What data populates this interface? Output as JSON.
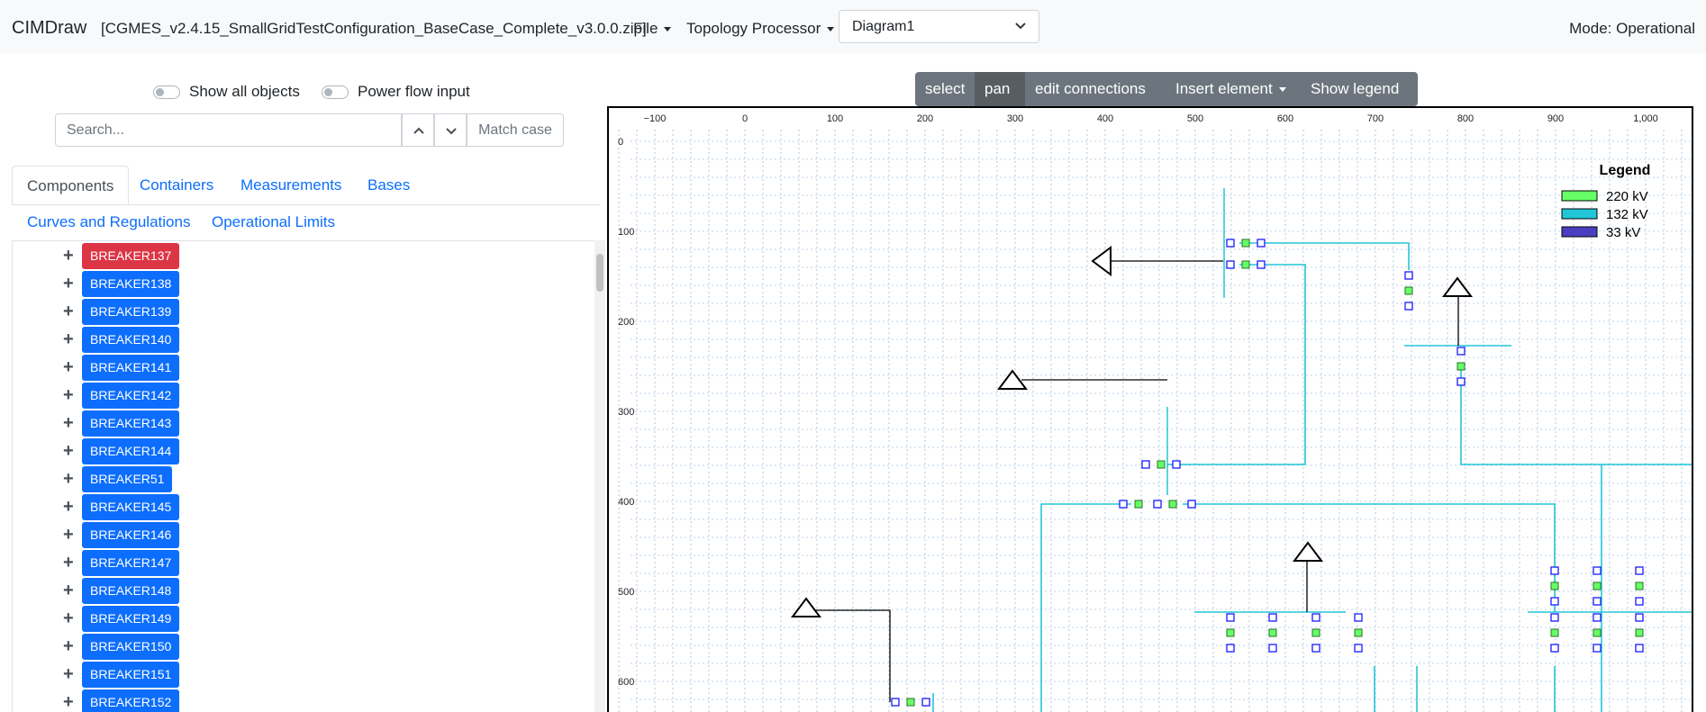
{
  "navbar": {
    "brand": "CIMDraw",
    "filename": "[CGMES_v2.4.15_SmallGridTestConfiguration_BaseCase_Complete_v3.0.0.zip]",
    "file_menu": "File",
    "topology_menu": "Topology Processor",
    "diagram_select": "Diagram1",
    "mode": "Mode: Operational"
  },
  "options": {
    "show_all_objects": "Show all objects",
    "power_flow_input": "Power flow input"
  },
  "search": {
    "placeholder": "Search...",
    "match_case": "Match case"
  },
  "tabs": {
    "components": "Components",
    "containers": "Containers",
    "measurements": "Measurements",
    "bases": "Bases",
    "curves": "Curves and Regulations",
    "limits": "Operational Limits"
  },
  "tree_items": [
    {
      "label": "BREAKER137",
      "color": "#dc3545"
    },
    {
      "label": "BREAKER138",
      "color": "#0d6efd"
    },
    {
      "label": "BREAKER139",
      "color": "#0d6efd"
    },
    {
      "label": "BREAKER140",
      "color": "#0d6efd"
    },
    {
      "label": "BREAKER141",
      "color": "#0d6efd"
    },
    {
      "label": "BREAKER142",
      "color": "#0d6efd"
    },
    {
      "label": "BREAKER143",
      "color": "#0d6efd"
    },
    {
      "label": "BREAKER144",
      "color": "#0d6efd"
    },
    {
      "label": "BREAKER51",
      "color": "#0d6efd"
    },
    {
      "label": "BREAKER145",
      "color": "#0d6efd"
    },
    {
      "label": "BREAKER146",
      "color": "#0d6efd"
    },
    {
      "label": "BREAKER147",
      "color": "#0d6efd"
    },
    {
      "label": "BREAKER148",
      "color": "#0d6efd"
    },
    {
      "label": "BREAKER149",
      "color": "#0d6efd"
    },
    {
      "label": "BREAKER150",
      "color": "#0d6efd"
    },
    {
      "label": "BREAKER151",
      "color": "#0d6efd"
    },
    {
      "label": "BREAKER152",
      "color": "#0d6efd"
    }
  ],
  "toolbar": {
    "select": "select",
    "pan": "pan",
    "edit_connections": "edit connections",
    "insert_element": "Insert element",
    "show_legend": "Show legend"
  },
  "ruler": {
    "x_ticks": [
      "−100",
      "0",
      "100",
      "200",
      "300",
      "400",
      "500",
      "600",
      "700",
      "800",
      "900",
      "1,000"
    ],
    "y_ticks": [
      "0",
      "100",
      "200",
      "300",
      "400",
      "500",
      "600"
    ]
  },
  "legend": {
    "title": "Legend",
    "entries": [
      {
        "label": "220 kV",
        "color": "#66ff66"
      },
      {
        "label": "132 kV",
        "color": "#22c6d6"
      },
      {
        "label": "33 kV",
        "color": "#4a3fbf"
      }
    ]
  },
  "colors": {
    "line_132": "#22c6d6",
    "node": "#1a1aff",
    "breaker_fill": "#66ff66",
    "primary": "#0d6efd",
    "danger": "#dc3545"
  }
}
